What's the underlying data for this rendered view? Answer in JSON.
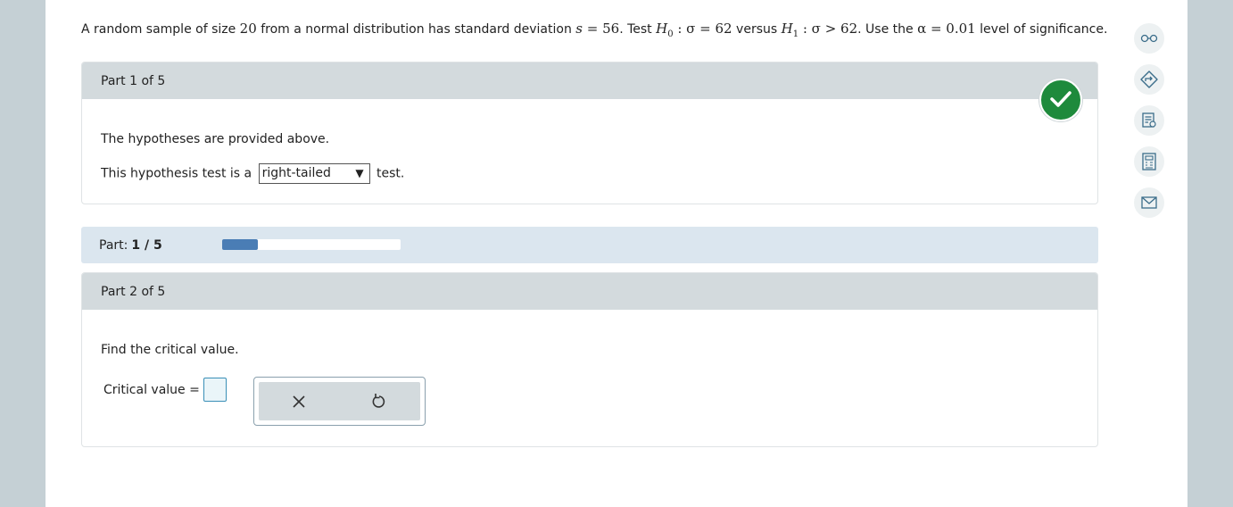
{
  "problem": {
    "t1": "A random sample of size ",
    "n": "20",
    "t2": " from a normal distribution has standard deviation ",
    "s_var": "s",
    "s_eq": " = 56",
    "t3": ". Test ",
    "h0": "H",
    "h0_sub": "0",
    "h0_rest": " : σ = 62",
    "t4": " versus ",
    "h1": "H",
    "h1_sub": "1",
    "h1_rest": " : σ > 62",
    "t5": ". Use the ",
    "alpha": "α = 0.01",
    "t6": " level of significance."
  },
  "part1": {
    "header": "Part 1 of 5",
    "line1": "The hypotheses are provided above.",
    "line2_prefix": "This hypothesis test is a",
    "select_value": "right-tailed",
    "line2_suffix": "test.",
    "status": "complete"
  },
  "progress": {
    "label": "Part:",
    "value": "1 / 5",
    "fraction": 0.2,
    "fill_color": "#4a7db5"
  },
  "part2": {
    "header": "Part 2 of 5",
    "prompt": "Find the critical value.",
    "label": "Critical value =",
    "input_value": ""
  },
  "tools": {
    "clear_icon": "close-icon",
    "undo_icon": "undo-icon"
  },
  "sidebar": [
    "glasses-icon",
    "diamond-arrow-icon",
    "notes-icon",
    "calculator-icon",
    "mail-icon"
  ],
  "colors": {
    "check": "#1e8a3c",
    "header_bg": "#d3dadd",
    "progress_bg": "#dbe6ef"
  }
}
